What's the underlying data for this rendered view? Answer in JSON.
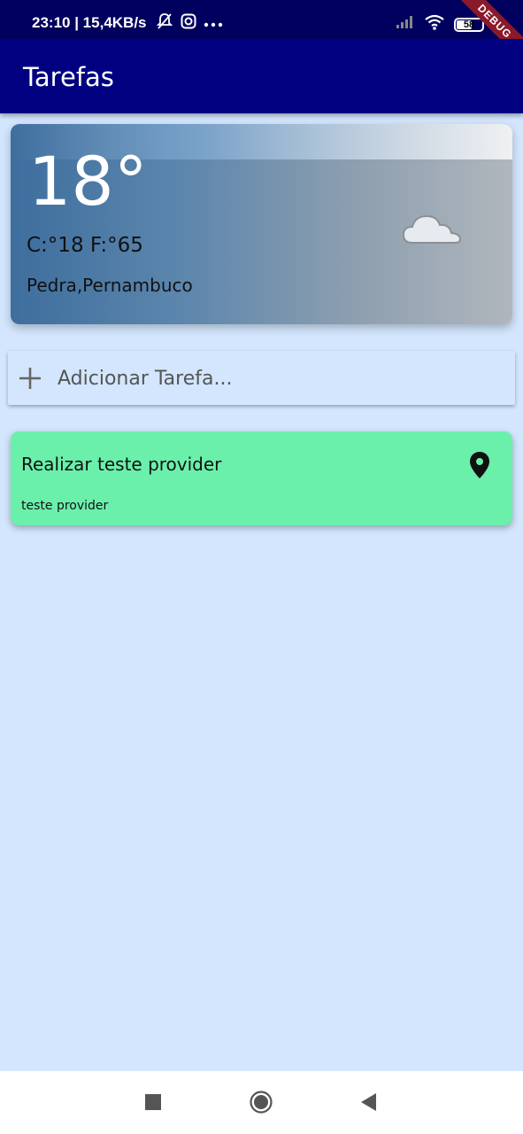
{
  "status_bar": {
    "time": "23:10 | 15,4KB/s",
    "battery": "58",
    "debug_label": "DEBUG",
    "icons": [
      "notifications-off-icon",
      "instagram-icon",
      "more-dots-icon",
      "signal-icon",
      "wifi-icon",
      "battery-icon"
    ]
  },
  "app_bar": {
    "title": "Tarefas"
  },
  "weather": {
    "temperature": "18°",
    "celsius_fahrenheit": "C:°18 F:°65",
    "location": "Pedra,Pernambuco",
    "icon": "night-cloudy-icon"
  },
  "add_task": {
    "placeholder": "Adicionar Tarefa...",
    "icon": "plus-icon"
  },
  "tasks": [
    {
      "title": "Realizar teste provider",
      "description": "teste provider",
      "icon": "location-pin-icon"
    }
  ],
  "nav": {
    "icons": [
      "recents-square-icon",
      "home-circle-icon",
      "back-triangle-icon"
    ]
  },
  "colors": {
    "status_bar": "#00005f",
    "app_bar": "#000080",
    "background": "#d3e6fd",
    "task_card": "#6af0ab"
  }
}
